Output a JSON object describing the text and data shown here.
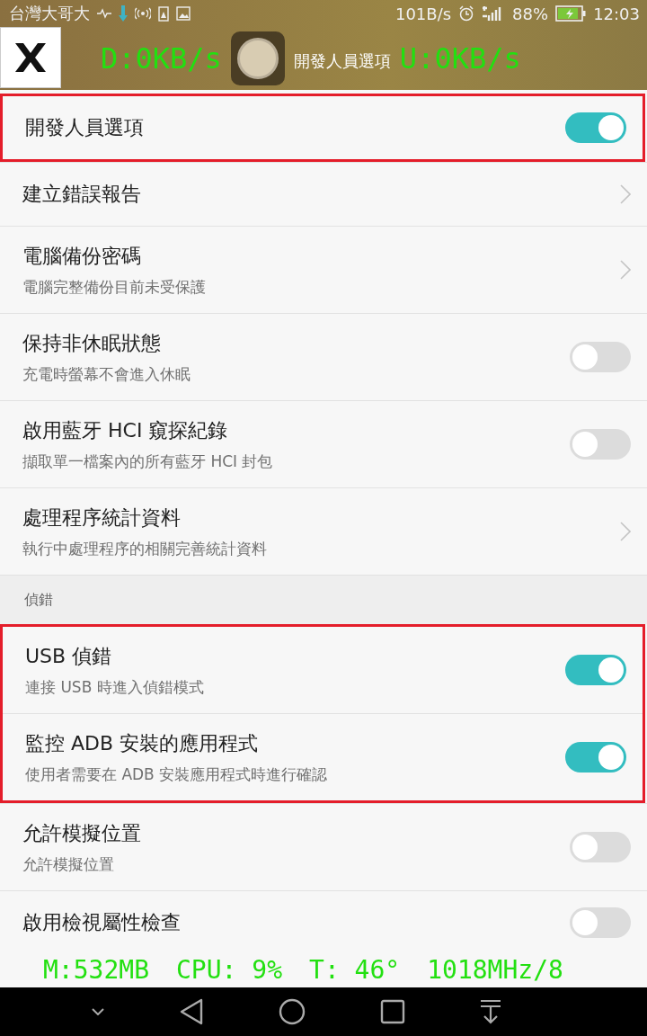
{
  "status_bar": {
    "carrier": "台灣大哥大",
    "speed": "101B/s",
    "battery_text": "88%",
    "time": "12:03"
  },
  "app_bar": {
    "title": "開發人員選項"
  },
  "net_overlay": [
    "D:0KB/s",
    "U:0KB/s"
  ],
  "blocks": [
    {
      "kind": "group",
      "highlighted": true,
      "items": [
        {
          "kind": "switch",
          "title": "開發人員選項",
          "on": true
        }
      ]
    },
    {
      "kind": "group",
      "highlighted": false,
      "items": [
        {
          "kind": "link",
          "title": "建立錯誤報告"
        },
        {
          "kind": "link",
          "title": "電腦備份密碼",
          "subtitle": "電腦完整備份目前未受保護"
        },
        {
          "kind": "switch",
          "title": "保持非休眠狀態",
          "subtitle": "充電時螢幕不會進入休眠",
          "on": false
        },
        {
          "kind": "switch",
          "title": "啟用藍牙 HCI 窺探紀錄",
          "subtitle": "擷取單一檔案內的所有藍牙 HCI 封包",
          "on": false
        },
        {
          "kind": "link",
          "title": "處理程序統計資料",
          "subtitle": "執行中處理程序的相關完善統計資料"
        }
      ]
    },
    {
      "kind": "header",
      "label": "偵錯"
    },
    {
      "kind": "group",
      "highlighted": true,
      "items": [
        {
          "kind": "switch",
          "title": "USB 偵錯",
          "subtitle": "連接 USB 時進入偵錯模式",
          "on": true
        },
        {
          "kind": "switch",
          "title": "監控 ADB 安裝的應用程式",
          "subtitle": "使用者需要在 ADB 安裝應用程式時進行確認",
          "on": true
        }
      ]
    },
    {
      "kind": "group",
      "highlighted": false,
      "items": [
        {
          "kind": "switch",
          "title": "允許模擬位置",
          "subtitle": "允許模擬位置",
          "on": false
        },
        {
          "kind": "switch",
          "title": "啟用檢視屬性檢查",
          "on": false
        }
      ]
    }
  ],
  "stats_overlay": [
    "M:532MB",
    "CPU: 9%",
    "T: 46°",
    "1018MHz/8"
  ]
}
